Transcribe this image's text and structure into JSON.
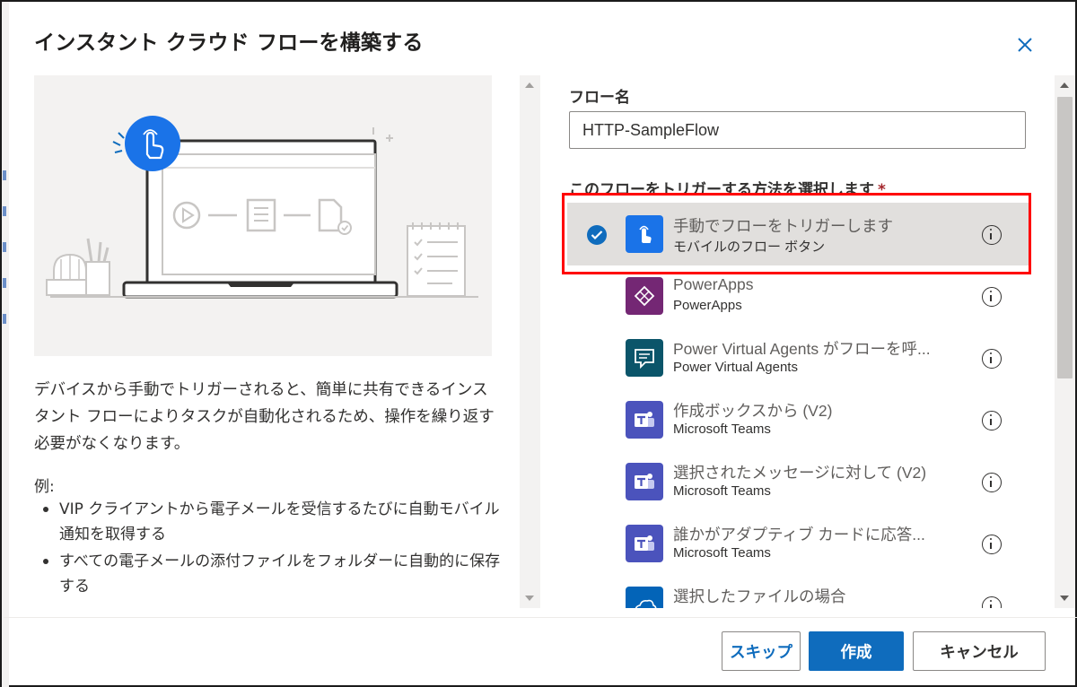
{
  "dialog": {
    "title": "インスタント クラウド フローを構築する",
    "close_label": "close"
  },
  "description": {
    "text": "デバイスから手動でトリガーされると、簡単に共有できるインスタント フローによりタスクが自動化されるため、操作を繰り返す必要がなくなります。",
    "example_label": "例:",
    "examples": [
      "VIP クライアントから電子メールを受信するたびに自動モバイル通知を取得する",
      "すべての電子メールの添付ファイルをフォルダーに自動的に保存する"
    ]
  },
  "form": {
    "flow_name_label": "フロー名",
    "flow_name_value": "HTTP-SampleFlow",
    "trigger_label": "このフローをトリガーする方法を選択します",
    "required_marker": "*"
  },
  "triggers": [
    {
      "title": "手動でフローをトリガーします",
      "subtitle": "モバイルのフロー ボタン",
      "icon": "touch-icon",
      "color": "#1a73e8",
      "selected": true
    },
    {
      "title": "PowerApps",
      "subtitle": "PowerApps",
      "icon": "powerapps-icon",
      "color": "#742774",
      "selected": false
    },
    {
      "title": "Power Virtual Agents がフローを呼...",
      "subtitle": "Power Virtual Agents",
      "icon": "chat-bubble-icon",
      "color": "#0b556a",
      "selected": false
    },
    {
      "title": "作成ボックスから (V2)",
      "subtitle": "Microsoft Teams",
      "icon": "teams-icon",
      "color": "#4b53bc",
      "selected": false
    },
    {
      "title": "選択されたメッセージに対して (V2)",
      "subtitle": "Microsoft Teams",
      "icon": "teams-icon",
      "color": "#4b53bc",
      "selected": false
    },
    {
      "title": "誰かがアダプティブ カードに応答...",
      "subtitle": "Microsoft Teams",
      "icon": "teams-icon",
      "color": "#4b53bc",
      "selected": false
    },
    {
      "title": "選択したファイルの場合",
      "subtitle": "",
      "icon": "onedrive-icon",
      "color": "#0364b8",
      "selected": false
    }
  ],
  "footer": {
    "skip_label": "スキップ",
    "create_label": "作成",
    "cancel_label": "キャンセル"
  }
}
